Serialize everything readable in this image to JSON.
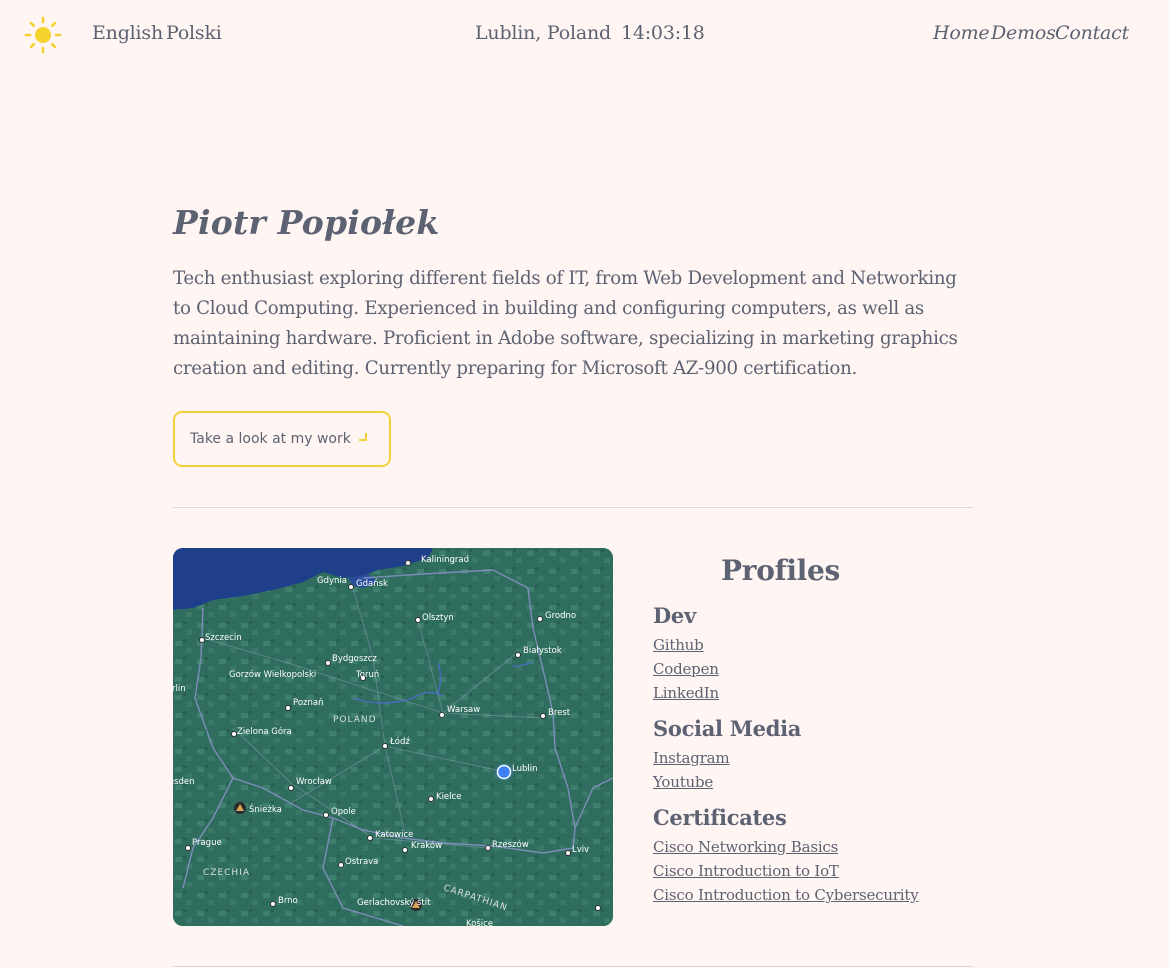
{
  "header": {
    "languages": [
      "English",
      "Polski"
    ],
    "location": "Lublin, Poland",
    "time": "14:03:18",
    "nav": [
      "Home",
      "Demos",
      "Contact"
    ],
    "theme_icon": "sun-icon"
  },
  "intro": {
    "name": "Piotr Popiołek",
    "bio": "Tech enthusiast exploring different fields of IT, from Web Development and Networking to Cloud Computing. Experienced in building and configuring computers, as well as maintaining hardware. Proficient in Adobe software, specializing in marketing graphics creation and editing. Currently preparing for Microsoft AZ-900 certification.",
    "cta_label": "Take a look at my work",
    "cta_icon": "arrow-down-right-icon"
  },
  "map": {
    "cities": [
      "Kaliningrad",
      "Gdynia",
      "Gdańsk",
      "Olsztyn",
      "Grodno",
      "Szczecin",
      "Bydgoszcz",
      "Białystok",
      "Toruń",
      "Gorzów Wielkopolski",
      "Poznań",
      "Warsaw",
      "Brest",
      "POLAND",
      "Zielona Góra",
      "Łódź",
      "Lublin",
      "Wrocław",
      "Kielce",
      "Śnieżka",
      "Opole",
      "Katowice",
      "Kraków",
      "Rzeszów",
      "Lviv",
      "Prague",
      "Ostrava",
      "CZECHIA",
      "Brno",
      "Gerlachovský štít",
      "CARPATHIAN",
      "Košice",
      "Berlin",
      "Dresden"
    ],
    "current_location": "Lublin"
  },
  "profiles": {
    "title": "Profiles",
    "groups": [
      {
        "title": "Dev",
        "links": [
          "Github",
          "Codepen",
          "LinkedIn"
        ]
      },
      {
        "title": "Social Media",
        "links": [
          "Instagram",
          "Youtube"
        ]
      },
      {
        "title": "Certificates",
        "links": [
          "Cisco Networking Basics",
          "Cisco Introduction to IoT",
          "Cisco Introduction to Cybersecurity"
        ]
      }
    ]
  },
  "colors": {
    "background": "#fff5f3",
    "text": "#5d6272",
    "accent": "#f4d13a",
    "map_land": "#2f6e5f",
    "map_sea": "#1f3f8a",
    "location_dot": "#3b82f6"
  }
}
